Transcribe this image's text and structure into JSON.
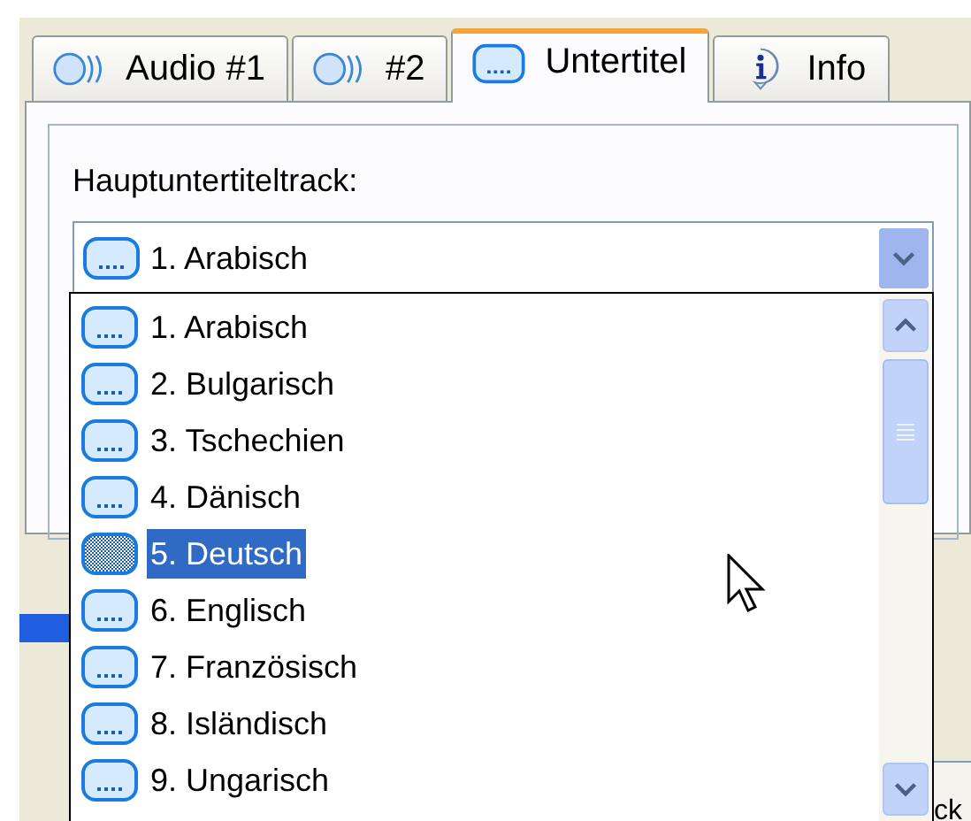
{
  "tabs": [
    {
      "label": "Audio #1",
      "kind": "audio",
      "selected": false
    },
    {
      "label": "#2",
      "kind": "audio",
      "selected": false
    },
    {
      "label": "Untertitel",
      "kind": "subtitle",
      "selected": true
    },
    {
      "label": "Info",
      "kind": "info",
      "selected": false
    }
  ],
  "group": {
    "label": "Hauptuntertiteltrack:"
  },
  "combo": {
    "value": "1. Arabisch",
    "expanded": true
  },
  "options": [
    {
      "label": "1. Arabisch",
      "selected": false
    },
    {
      "label": "2. Bulgarisch",
      "selected": false
    },
    {
      "label": "3. Tschechien",
      "selected": false
    },
    {
      "label": "4. Dänisch",
      "selected": false
    },
    {
      "label": "5. Deutsch",
      "selected": true
    },
    {
      "label": "6. Englisch",
      "selected": false
    },
    {
      "label": "7. Französisch",
      "selected": false
    },
    {
      "label": "8. Isländisch",
      "selected": false
    },
    {
      "label": "9. Ungarisch",
      "selected": false
    }
  ],
  "background": {
    "right_text": "ck"
  }
}
